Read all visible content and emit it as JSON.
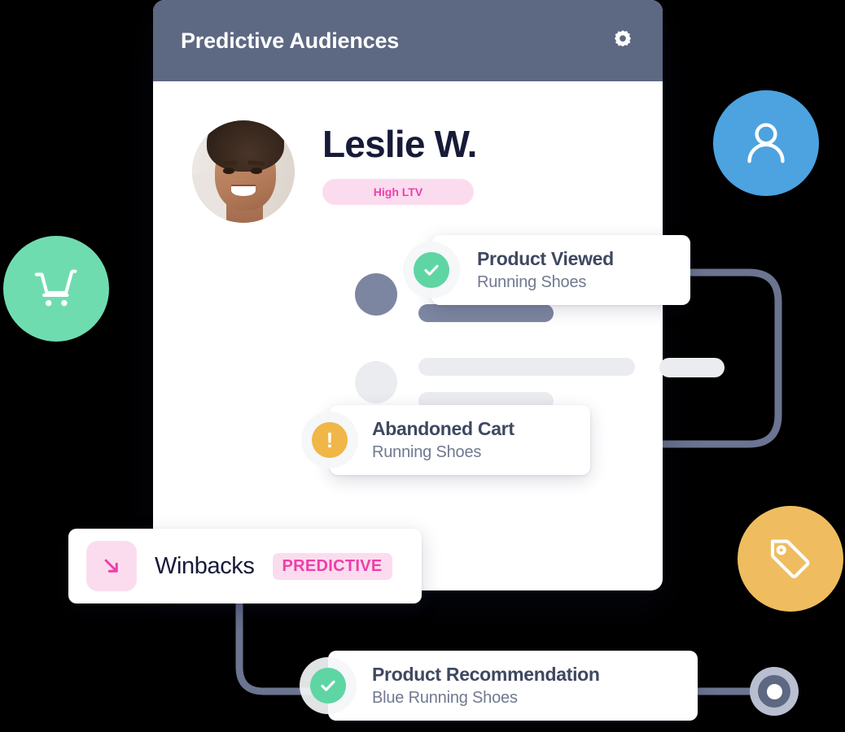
{
  "panel": {
    "header": {
      "title": "Predictive Audiences",
      "settings_icon": "gear-icon",
      "background_color": "#5D6882",
      "title_color": "#FFFFFF"
    },
    "profile": {
      "avatar_alt": "Leslie W. profile photo",
      "name": "Leslie W.",
      "badge": {
        "label": "High LTV",
        "background_color": "#FBDCEF",
        "text_color": "#EE3FA8"
      }
    },
    "skeleton_rows": [
      {
        "tone": "dark",
        "color": "#7D86A1"
      },
      {
        "tone": "light",
        "color": "#EAECF0"
      }
    ]
  },
  "event_cards": [
    {
      "id": "product-viewed",
      "title": "Product Viewed",
      "subtitle": "Running Shoes",
      "status": "success",
      "badge_icon": "check-icon",
      "badge_color": "#5FD5A4"
    },
    {
      "id": "abandoned-cart",
      "title": "Abandoned Cart",
      "subtitle": "Running Shoes",
      "status": "warning",
      "badge_icon": "exclamation-icon",
      "badge_label": "!",
      "badge_color": "#F0B647"
    },
    {
      "id": "product-recommendation",
      "title": "Product Recommendation",
      "subtitle": "Blue Running Shoes",
      "status": "success",
      "badge_icon": "check-icon",
      "badge_color": "#5FD5A4"
    }
  ],
  "winbacks_card": {
    "icon": "arrow-down-right-icon",
    "icon_color": "#EE3FA8",
    "icon_background": "#FBDCEF",
    "label": "Winbacks",
    "badge": {
      "label": "PREDICTIVE",
      "background_color": "#FBDCEF",
      "text_color": "#EE3FA8"
    }
  },
  "floating_icons": [
    {
      "id": "cart",
      "icon": "shopping-cart-icon",
      "background_color": "#6FDCB0"
    },
    {
      "id": "user",
      "icon": "user-icon",
      "background_color": "#4CA3E0"
    },
    {
      "id": "tag",
      "icon": "tag-icon",
      "background_color": "#EFBD5F"
    }
  ],
  "connector": {
    "color": "#6B7490",
    "end_node": {
      "outer_color": "#B9BFD0",
      "ring_color": "#5D6882",
      "core_color": "#FFFFFF"
    }
  }
}
